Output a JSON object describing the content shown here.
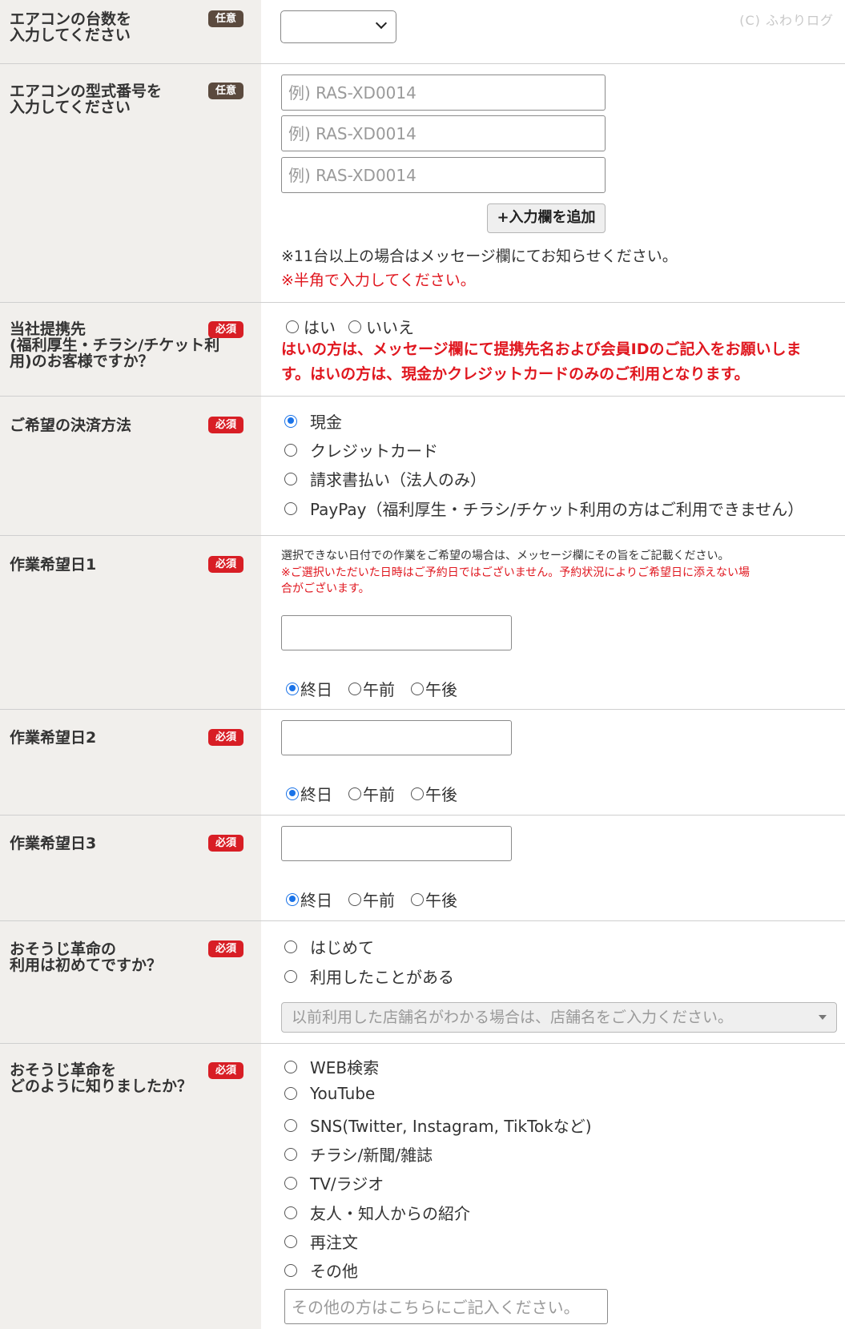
{
  "watermark": "(C) ふわりログ",
  "badges": {
    "optional": "任意",
    "required": "必須"
  },
  "unit_count": {
    "label_line1": "エアコンの台数を",
    "label_line2": "入力してください",
    "selected": ""
  },
  "model_numbers": {
    "label_line1": "エアコンの型式番号を",
    "label_line2": "入力してください",
    "inputs": [
      {
        "placeholder": "例) RAS-XD0014"
      },
      {
        "placeholder": "例) RAS-XD0014"
      },
      {
        "placeholder": "例) RAS-XD0014"
      }
    ],
    "add_button": "+入力欄を追加",
    "note": "※11台以上の場合はメッセージ欄にてお知らせください。",
    "note_red": "※半角で入力してください。"
  },
  "partner": {
    "label_line1": "当社提携先",
    "label_line2": "(福利厚生・チラシ/チケット利",
    "label_line3": "用)のお客様ですか？",
    "options": [
      "はい",
      "いいえ"
    ],
    "warning_line1": "はいの方は、メッセージ欄にて提携先名および会員IDのご記入をお願いしま",
    "warning_line2": "す。はいの方は、現金かクレジットカードのみのご利用となります。"
  },
  "payment": {
    "label": "ご希望の決済方法",
    "options": [
      {
        "label": "現金",
        "checked": true
      },
      {
        "label": "クレジットカード",
        "checked": false
      },
      {
        "label": "請求書払い（法人のみ）",
        "checked": false
      },
      {
        "label": "PayPay（福利厚生・チラシ/チケット利用の方はご利用できません）",
        "checked": false
      }
    ]
  },
  "date1": {
    "label": "作業希望日1",
    "note": "選択できない日付での作業をご希望の場合は、メッセージ欄にその旨をご記載ください。",
    "note_red_line1": "※ご選択いただいた日時はご予約日ではございません。予約状況によりご希望日に添えない場",
    "note_red_line2": "合がございます。",
    "value": "",
    "times": [
      "終日",
      "午前",
      "午後"
    ]
  },
  "date2": {
    "label": "作業希望日2",
    "value": "",
    "times": [
      "終日",
      "午前",
      "午後"
    ]
  },
  "date3": {
    "label": "作業希望日3",
    "value": "",
    "times": [
      "終日",
      "午前",
      "午後"
    ]
  },
  "first_time": {
    "label_line1": "おそうじ革命の",
    "label_line2": "利用は初めてですか？",
    "options": [
      "はじめて",
      "利用したことがある"
    ],
    "store_placeholder": "以前利用した店舗名がわかる場合は、店舗名をご入力ください。"
  },
  "source": {
    "label_line1": "おそうじ革命を",
    "label_line2": "どのように知りましたか？",
    "options": [
      "WEB検索",
      "YouTube",
      "SNS(Twitter, Instagram, TikTokなど)",
      "チラシ/新聞/雑誌",
      "TV/ラジオ",
      "友人・知人からの紹介",
      "再注文",
      "その他"
    ],
    "other_placeholder": "その他の方はこちらにご記入ください。"
  }
}
